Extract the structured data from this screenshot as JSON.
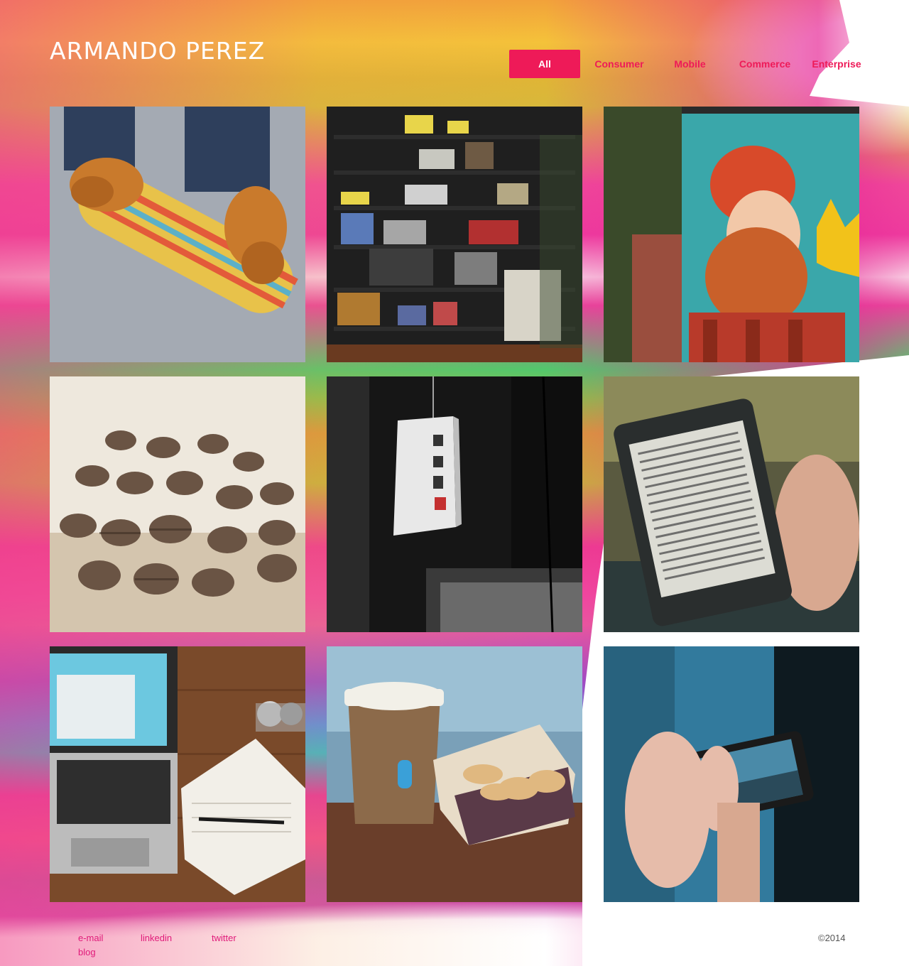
{
  "header": {
    "title": "ARMANDO PEREZ",
    "filters": [
      "All",
      "Consumer",
      "Mobile",
      "Commerce",
      "Enterprise"
    ],
    "active_filter": "All"
  },
  "portfolio": {
    "items": [
      {
        "subject": "skateboard-shoes"
      },
      {
        "subject": "bookshelf"
      },
      {
        "subject": "bearded-man-mural"
      },
      {
        "subject": "coffee-beans"
      },
      {
        "subject": "paper-lantern"
      },
      {
        "subject": "kindle-reader"
      },
      {
        "subject": "laptop-notebook-desk"
      },
      {
        "subject": "coffee-cup-macarons"
      },
      {
        "subject": "phone-photo"
      }
    ]
  },
  "footer": {
    "links": {
      "email": "e-mail",
      "linkedin": "linkedin",
      "twitter": "twitter",
      "blog": "blog"
    },
    "copyright": "©2014"
  },
  "colors": {
    "accent": "#ee1a58",
    "title": "#ffffff"
  }
}
